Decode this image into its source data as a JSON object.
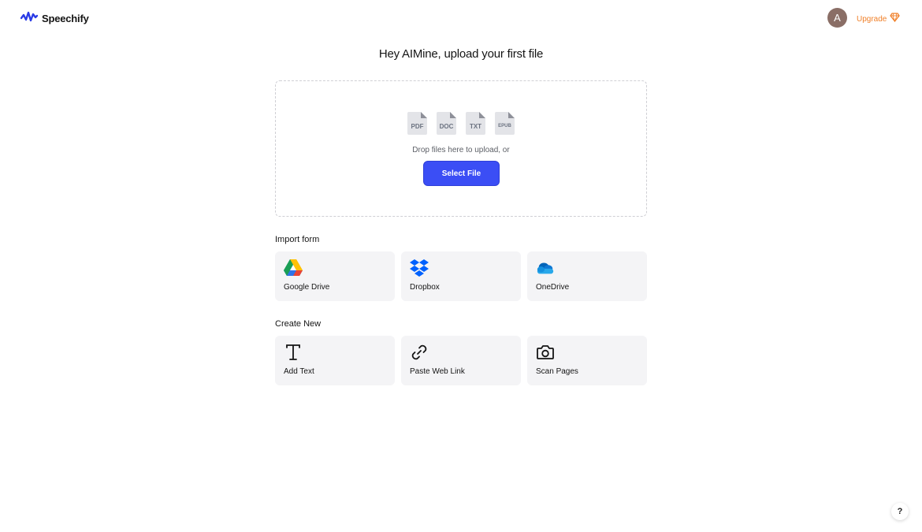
{
  "header": {
    "brand": "Speechify",
    "avatar_initial": "A",
    "upgrade_label": "Upgrade"
  },
  "headline": "Hey AIMine, upload your first file",
  "upload": {
    "file_types": [
      "PDF",
      "DOC",
      "TXT",
      "EPUB"
    ],
    "drop_text": "Drop files here to upload, or",
    "select_label": "Select File"
  },
  "import": {
    "title": "Import form",
    "items": [
      {
        "label": "Google Drive",
        "icon": "google-drive-icon"
      },
      {
        "label": "Dropbox",
        "icon": "dropbox-icon"
      },
      {
        "label": "OneDrive",
        "icon": "onedrive-icon"
      }
    ]
  },
  "create": {
    "title": "Create New",
    "items": [
      {
        "label": "Add Text",
        "icon": "text-icon"
      },
      {
        "label": "Paste Web Link",
        "icon": "link-icon"
      },
      {
        "label": "Scan Pages",
        "icon": "camera-icon"
      }
    ]
  },
  "help_label": "?",
  "colors": {
    "brand_blue": "#3b4ef5",
    "upgrade_orange": "#f0802a",
    "card_bg": "#f4f4f6"
  }
}
